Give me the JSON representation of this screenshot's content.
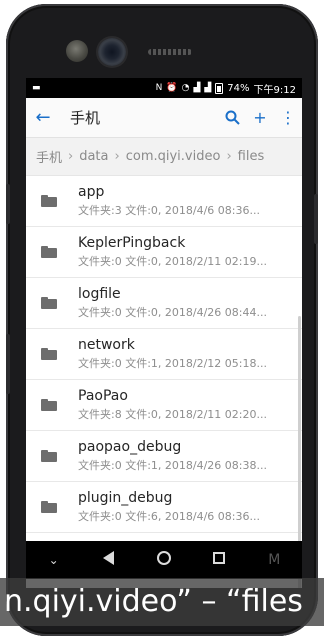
{
  "status": {
    "battery_pct": "74%",
    "time": "下午9:12"
  },
  "appbar": {
    "title": "手机"
  },
  "breadcrumb": [
    "手机",
    "data",
    "com.qiyi.video",
    "files"
  ],
  "files": [
    {
      "name": "app",
      "meta": "文件夹:3 文件:0, 2018/4/6 08:36..."
    },
    {
      "name": "KeplerPingback",
      "meta": "文件夹:0 文件:0, 2018/2/11 02:19..."
    },
    {
      "name": "logfile",
      "meta": "文件夹:0 文件:0, 2018/4/26 08:44..."
    },
    {
      "name": "network",
      "meta": "文件夹:0 文件:1, 2018/2/12 05:18..."
    },
    {
      "name": "PaoPao",
      "meta": "文件夹:8 文件:0, 2018/2/11 02:20..."
    },
    {
      "name": "paopao_debug",
      "meta": "文件夹:0 文件:1, 2018/4/26 08:38..."
    },
    {
      "name": "plugin_debug",
      "meta": "文件夹:0 文件:6, 2018/4/6 08:36..."
    }
  ],
  "navbar": {
    "m_label": "M"
  },
  "caption": "n.qiyi.video” – “files",
  "colors": {
    "accent": "#1a6fc9",
    "phone_body": "#1b1b1d"
  }
}
